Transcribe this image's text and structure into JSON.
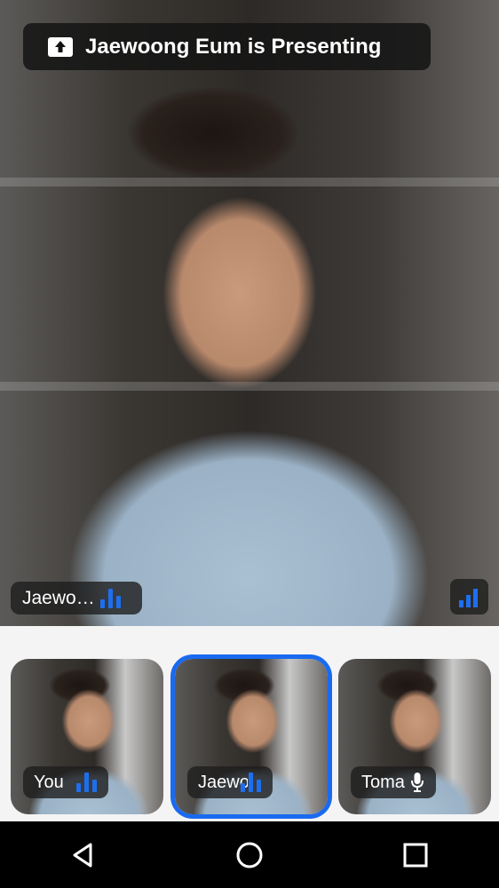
{
  "banner": {
    "text": "Jaewoong Eum is Presenting",
    "icon": "share-screen-icon"
  },
  "main_video": {
    "name_label": "Jaewo…",
    "audio_icon": "audio-level-icon",
    "signal_icon": "network-signal-icon"
  },
  "participants": [
    {
      "name": "You",
      "indicator": "audio-level-icon",
      "selected": false
    },
    {
      "name": "Jaewo…",
      "indicator": "audio-level-icon",
      "selected": true
    },
    {
      "name": "Toma …",
      "indicator": "microphone-icon",
      "selected": false
    }
  ],
  "navigation": {
    "back": "back-icon",
    "home": "home-icon",
    "recents": "recents-icon"
  },
  "colors": {
    "accent": "#1a6af0",
    "tag_background": "#1e1e1e",
    "strip_background": "#f4f4f4"
  }
}
